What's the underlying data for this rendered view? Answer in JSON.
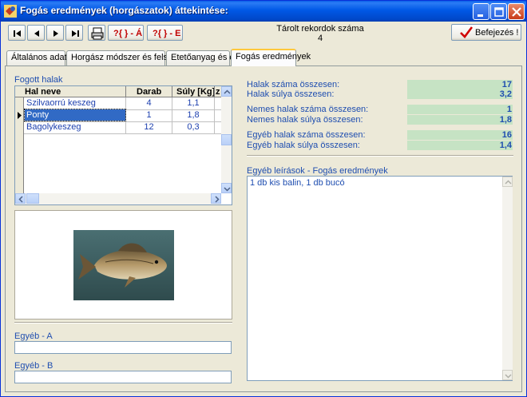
{
  "window": {
    "title": "Fogás eredmények (horgászatok) áttekintése:"
  },
  "toolbar": {
    "first_icon": "first-record-icon",
    "prev_icon": "prev-record-icon",
    "next_icon": "next-record-icon",
    "last_icon": "last-record-icon",
    "print_icon": "printer-icon",
    "query_a_label": "?{ } - Á",
    "query_e_label": "?{ } - E",
    "record_count_label": "Tárolt rekordok száma",
    "record_count_value": "4",
    "finish_label": "Befejezés !"
  },
  "tabs": [
    {
      "label": "Általános adatok"
    },
    {
      "label": "Horgász módszer és felszerelés"
    },
    {
      "label": "Etetőanyag és csali"
    },
    {
      "label": "Fogás eredmények"
    }
  ],
  "left": {
    "group_label": "Fogott halak",
    "grid": {
      "headers": [
        "Hal neve",
        "Darab",
        "Súly [Kg]",
        "z"
      ],
      "rows": [
        {
          "name": "Szilvaorrú keszeg",
          "count": "4",
          "weight": "1,1",
          "selected": false
        },
        {
          "name": "Ponty",
          "count": "1",
          "weight": "1,8",
          "selected": true
        },
        {
          "name": "Bagolykeszeg",
          "count": "12",
          "weight": "0,3",
          "selected": false
        }
      ]
    },
    "other_a_label": "Egyéb - A",
    "other_a_value": "",
    "other_b_label": "Egyéb - B",
    "other_b_value": ""
  },
  "right": {
    "stats": [
      {
        "label": "Halak száma összesen:",
        "value": "17"
      },
      {
        "label": "Halak súlya összesen:",
        "value": "3,2"
      },
      {
        "label": "Nemes halak száma összesen:",
        "value": "1"
      },
      {
        "label": "Nemes halak súlya összesen:",
        "value": "1,8"
      },
      {
        "label": "Egyéb halak száma összesen:",
        "value": "16"
      },
      {
        "label": "Egyéb halak súlya összesen:",
        "value": "1,4"
      }
    ],
    "memo_label": "Egyéb leírások - Fogás eredmények",
    "memo_text": "1 db kis balin, 1 db bucó"
  },
  "colors": {
    "accent": "#1f4eb0",
    "value_bg": "#c6e3c4",
    "titlebar": "#0058e6"
  }
}
